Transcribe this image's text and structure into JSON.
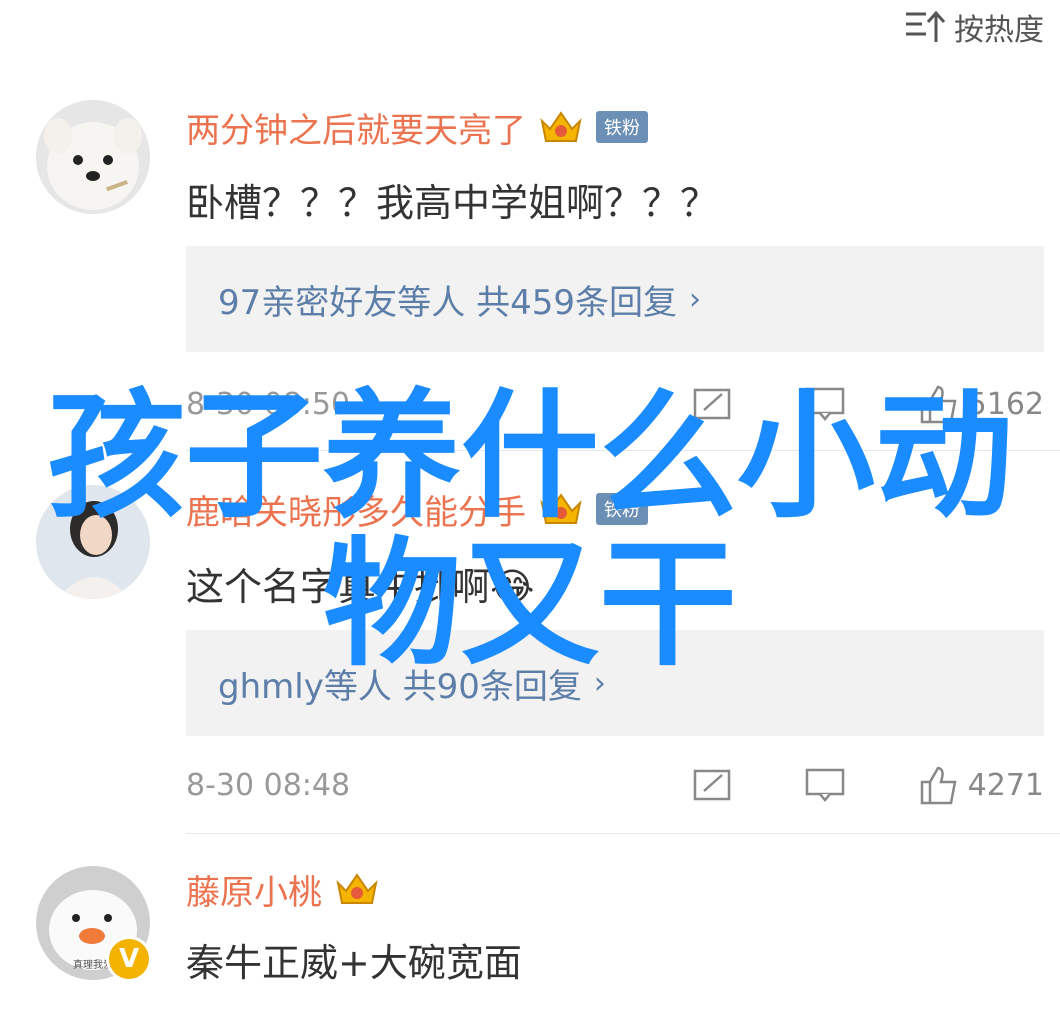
{
  "sort": {
    "label": "按热度",
    "icon": "sort-icon"
  },
  "comments": [
    {
      "username": "两分钟之后就要天亮了",
      "fan_badge": "铁粉",
      "text": "卧槽？？？我高中学姐啊？？？",
      "reply_summary": "97亲密好友等人 共459条回复",
      "reply_arrow": "›",
      "time": "8-30 08:50",
      "likes": "5162"
    },
    {
      "username": "鹿晗关晓彤多久能分手",
      "fan_badge": "铁粉",
      "text": "这个名字真牛批啊",
      "emoji": "😂",
      "reply_summary": "ghmly等人 共90条回复",
      "reply_arrow": "›",
      "time": "8-30 08:48",
      "likes": "4271"
    },
    {
      "username": "藤原小桃",
      "text": "秦牛正威+大碗宽面",
      "avatar_caption": "真理我爱"
    }
  ],
  "overlay": {
    "line1": "孩子养什么小动",
    "line2": "物又干"
  },
  "colors": {
    "username": "#eb7350",
    "link": "#5d7ea8",
    "overlay": "#1a8cff",
    "fan_badge": "#6c8fb6"
  }
}
